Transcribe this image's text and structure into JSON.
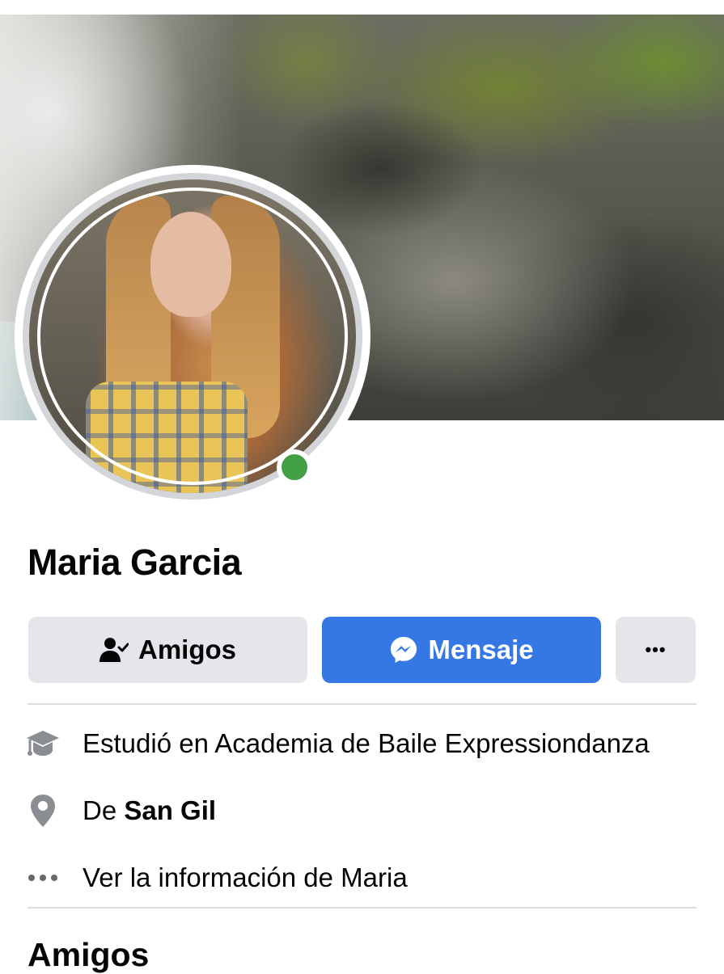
{
  "profile": {
    "name": "Maria Garcia",
    "online": true
  },
  "actions": {
    "friends_label": "Amigos",
    "message_label": "Mensaje",
    "more_label": "•••"
  },
  "info": {
    "education_text": "Estudió en Academia de Baile Expressiondanza",
    "location_prefix": "De ",
    "location_city": "San Gil",
    "about_text": "Ver la información de Maria"
  },
  "sections": {
    "friends_title": "Amigos"
  },
  "icons": {
    "friends": "person-check-icon",
    "message": "messenger-icon",
    "more": "more-dots-icon",
    "education": "graduation-cap-icon",
    "location": "location-pin-icon",
    "about": "ellipsis-icon"
  },
  "colors": {
    "primary": "#3578e5",
    "secondary_button": "#e4e6eb",
    "online_dot": "#44a047",
    "icon_gray": "#8a8d91",
    "text": "#050505"
  }
}
